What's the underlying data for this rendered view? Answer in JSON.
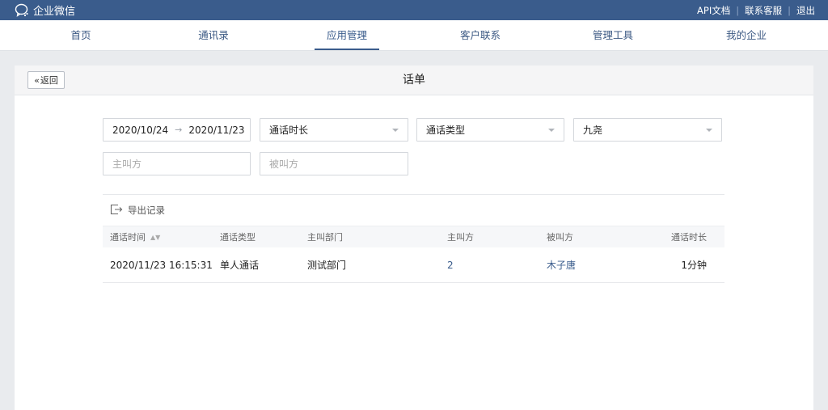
{
  "app": {
    "title": "企业微信"
  },
  "top_links": [
    "API文档",
    "联系客服",
    "退出"
  ],
  "nav": {
    "items": [
      "首页",
      "通讯录",
      "应用管理",
      "客户联系",
      "管理工具",
      "我的企业"
    ],
    "active": "应用管理"
  },
  "page": {
    "back_label": "返回",
    "title": "话单"
  },
  "filters": {
    "date_start": "2020/10/24",
    "date_end": "2020/11/23",
    "duration": "通话时长",
    "call_type": "通话类型",
    "person": "九尧",
    "caller_placeholder": "主叫方",
    "callee_placeholder": "被叫方"
  },
  "export_label": "导出记录",
  "table": {
    "columns": [
      "通话时间",
      "通话类型",
      "主叫部门",
      "主叫方",
      "被叫方",
      "通话时长"
    ],
    "rows": [
      [
        "2020/11/23 16:15:31",
        "单人通话",
        "测试部门",
        "2",
        "木子唐",
        "1分钟"
      ]
    ]
  },
  "colors": {
    "brand": "#3a5c8c",
    "link": "#3a5c8c"
  },
  "icons": [
    "wechat-work-logo-icon",
    "double-chevron-left-icon",
    "sort-icon",
    "export-icon",
    "chevron-down-icon"
  ]
}
